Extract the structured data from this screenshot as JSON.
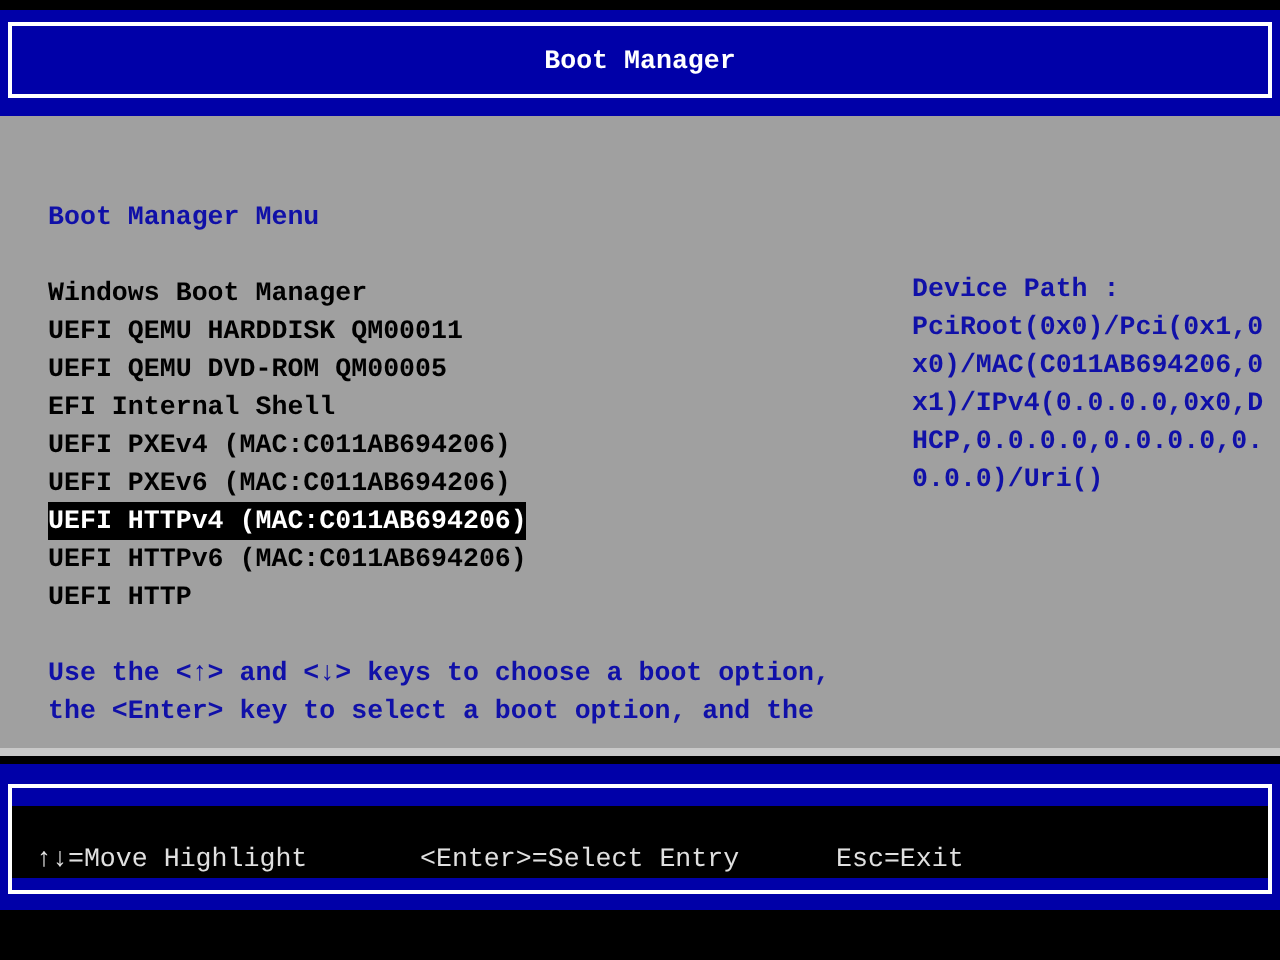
{
  "header": {
    "title": "Boot Manager"
  },
  "menu": {
    "title": "Boot Manager Menu",
    "items": [
      {
        "label": "Windows Boot Manager",
        "selected": false
      },
      {
        "label": "UEFI QEMU HARDDISK QM00011",
        "selected": false
      },
      {
        "label": "UEFI QEMU DVD-ROM QM00005",
        "selected": false
      },
      {
        "label": "EFI Internal Shell",
        "selected": false
      },
      {
        "label": "UEFI PXEv4 (MAC:C011AB694206)",
        "selected": false
      },
      {
        "label": "UEFI PXEv6 (MAC:C011AB694206)",
        "selected": false
      },
      {
        "label": "UEFI HTTPv4 (MAC:C011AB694206)",
        "selected": true
      },
      {
        "label": "UEFI HTTPv6 (MAC:C011AB694206)",
        "selected": false
      },
      {
        "label": "UEFI HTTP",
        "selected": false
      }
    ],
    "help_lines": [
      "Use the <↑> and <↓> keys to choose a boot option,",
      "the <Enter> key to select a boot option, and the"
    ]
  },
  "device_path": {
    "lines": [
      "Device Path :",
      "PciRoot(0x0)/Pci(0x1,0",
      "x0)/MAC(C011AB694206,0",
      "x1)/IPv4(0.0.0.0,0x0,D",
      "HCP,0.0.0.0,0.0.0.0,0.",
      "0.0.0)/Uri()"
    ]
  },
  "footer": {
    "hints": [
      "↑↓=Move Highlight",
      "<Enter>=Select Entry",
      "Esc=Exit"
    ]
  }
}
